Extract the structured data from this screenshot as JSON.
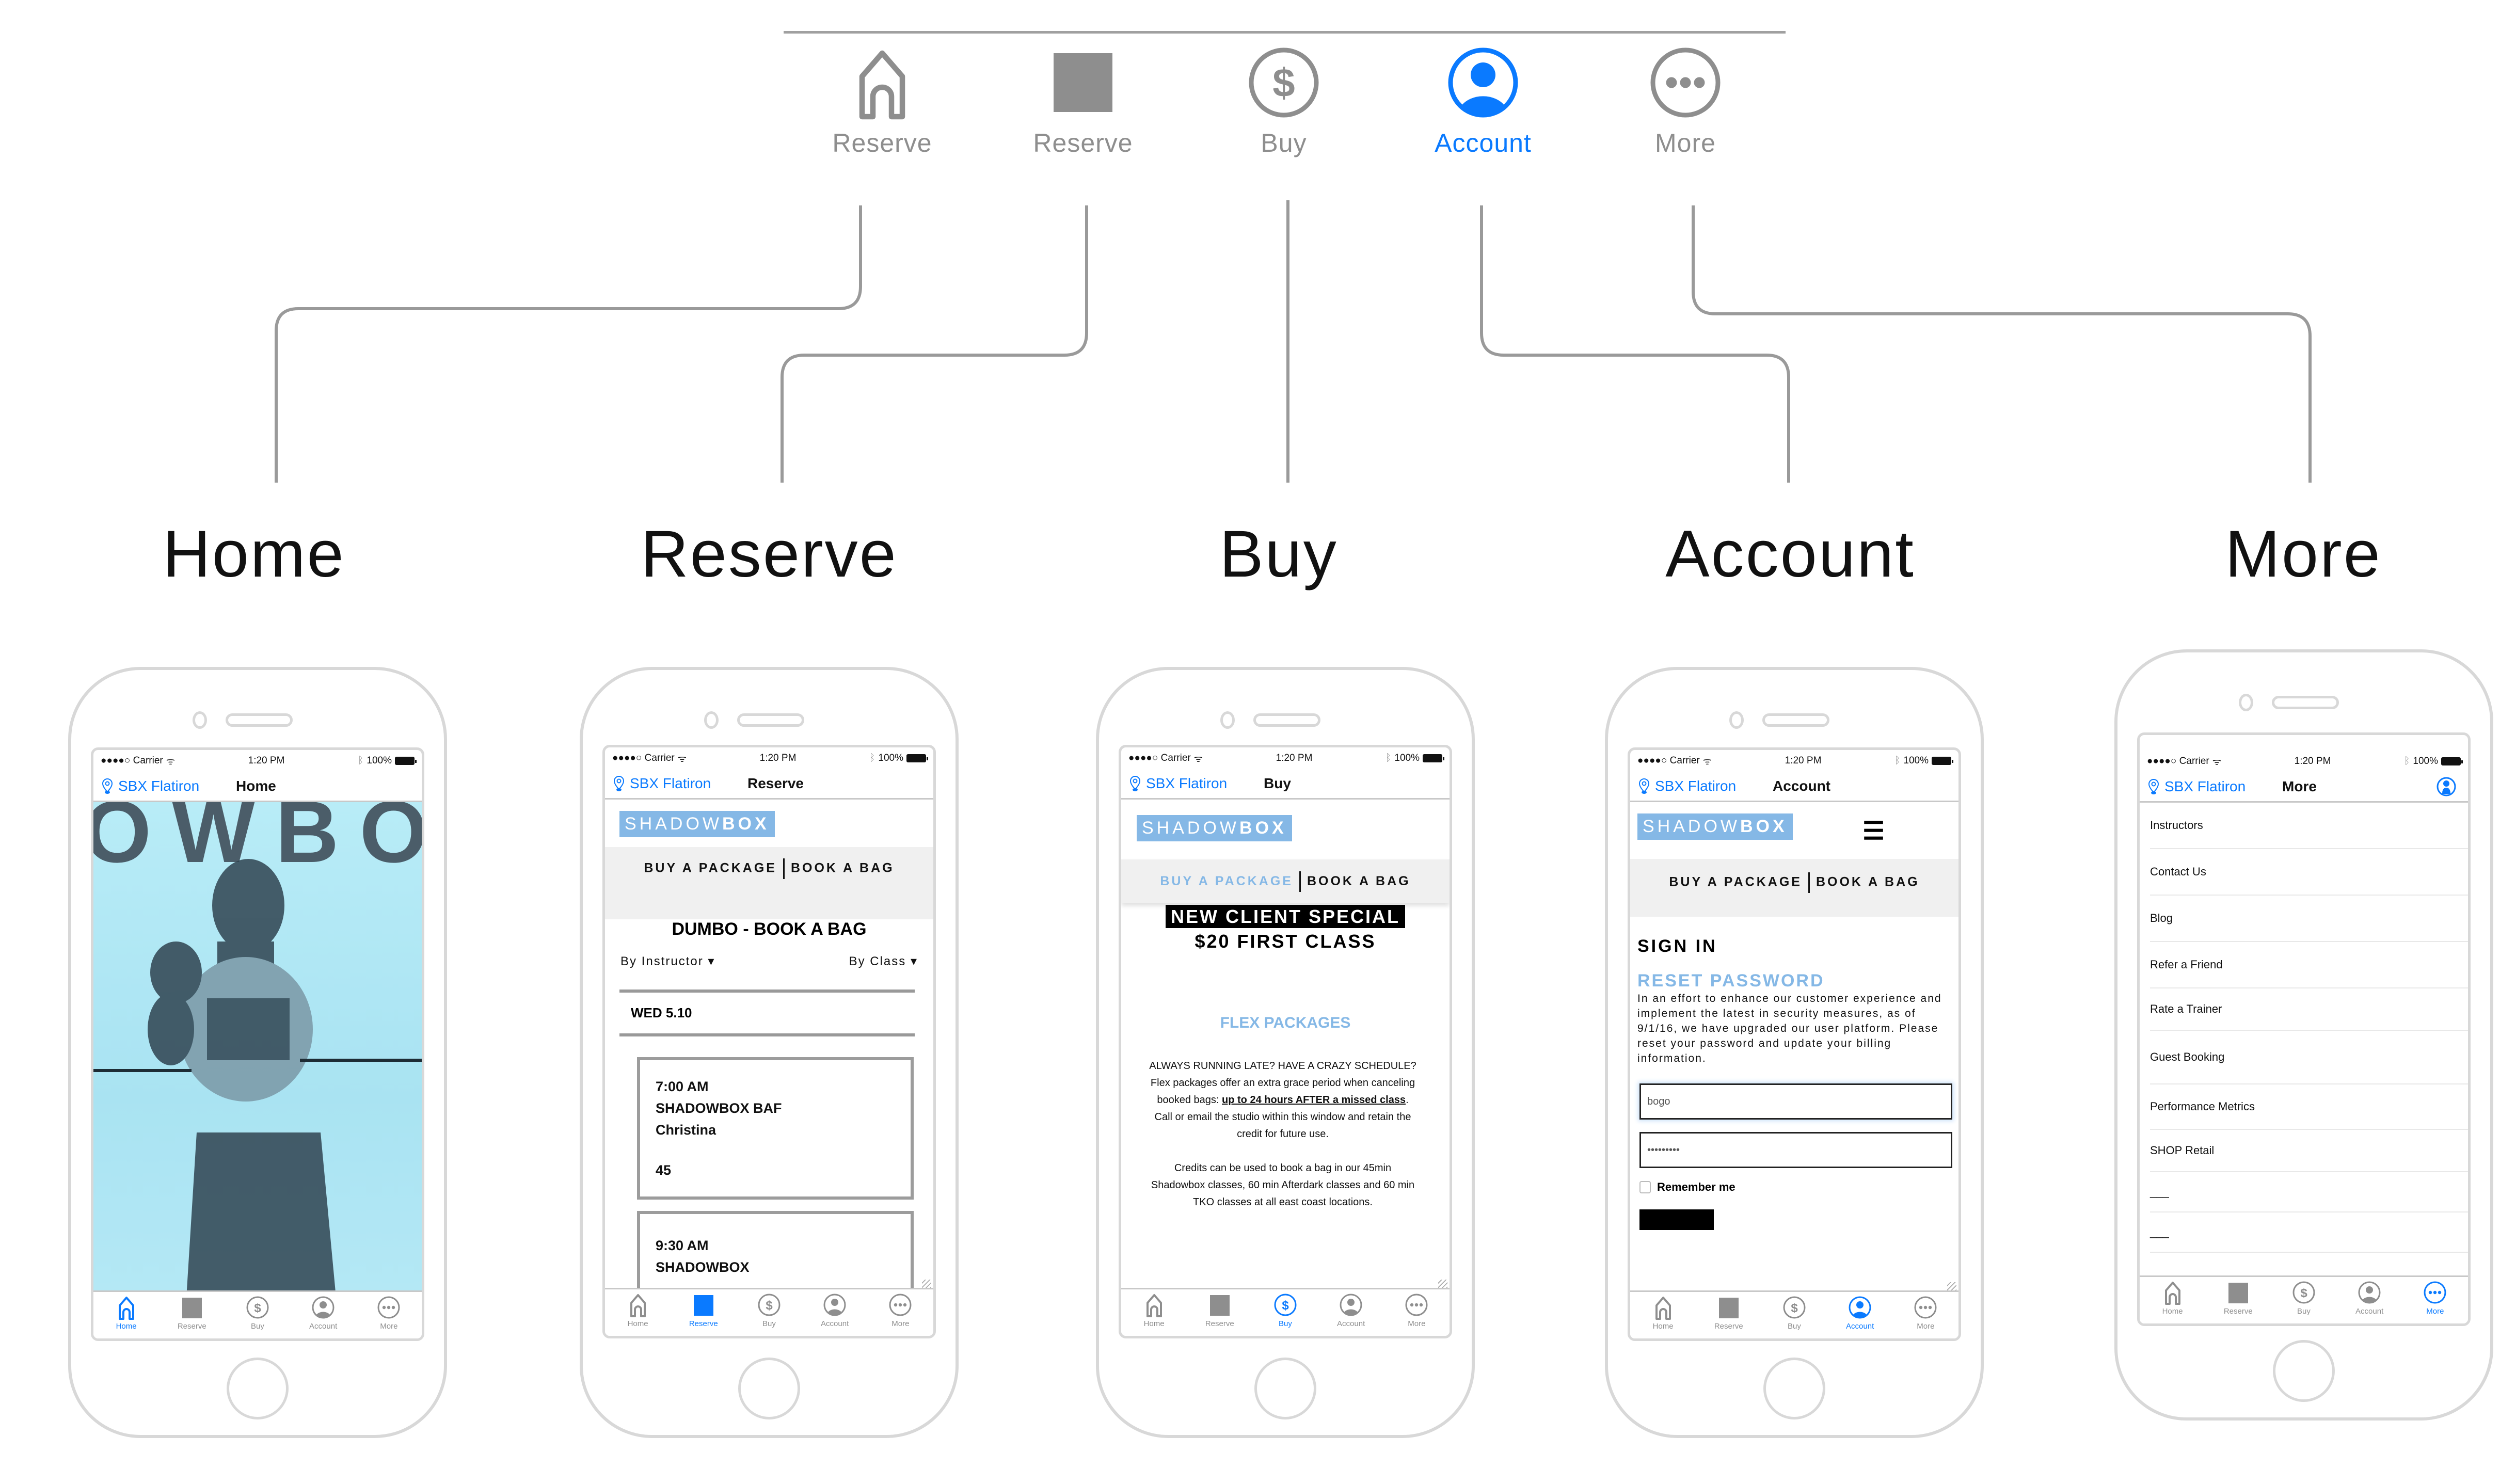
{
  "top_tabs": [
    {
      "label": "Reserve",
      "icon": "home-icon",
      "active": false
    },
    {
      "label": "Reserve",
      "icon": "reserve-square-icon",
      "active": false
    },
    {
      "label": "Buy",
      "icon": "dollar-circle-icon",
      "active": false
    },
    {
      "label": "Account",
      "icon": "account-circle-icon",
      "active": true
    },
    {
      "label": "More",
      "icon": "more-ellipsis-icon",
      "active": false
    }
  ],
  "sections": [
    "Home",
    "Reserve",
    "Buy",
    "Account",
    "More"
  ],
  "colors": {
    "accent": "#0a7aff",
    "inactive": "#8e8e8e",
    "brand_blue": "#85b8e6",
    "connector": "#9a9a9a"
  },
  "status_bar": {
    "carrier": "●●●●○ Carrier",
    "time": "1:20 PM",
    "battery": "100%"
  },
  "location": "SBX Flatiron",
  "tabbar": [
    "Home",
    "Reserve",
    "Buy",
    "Account",
    "More"
  ],
  "brand": {
    "light": "SHADOW",
    "bold": "BOX"
  },
  "pkg_nav": {
    "buy": "BUY A PACKAGE",
    "book": "BOOK A BAG"
  },
  "screens": {
    "home": {
      "title": "Home",
      "hero_text": "OWBO"
    },
    "reserve": {
      "title": "Reserve",
      "heading": "DUMBO - BOOK A BAG",
      "filter_instructor": "By Instructor ▾",
      "filter_class": "By Class ▾",
      "date": "WED 5.10",
      "classes": [
        {
          "time": "7:00 AM",
          "name": "SHADOWBOX BAF",
          "instructor": "Christina",
          "duration": "45"
        },
        {
          "time": "9:30 AM",
          "name": "SHADOWBOX",
          "instructor": "",
          "duration": ""
        }
      ]
    },
    "buy": {
      "title": "Buy",
      "special_banner": "NEW CLIENT SPECIAL",
      "special_sub": "$20 FIRST CLASS",
      "flex_heading": "FLEX PACKAGES",
      "flex_q": "ALWAYS RUNNING LATE? HAVE A CRAZY SCHEDULE?",
      "flex_p1_pre": "Flex packages offer an extra grace period when canceling booked bags: ",
      "flex_p1_link": "up to 24 hours AFTER a missed class",
      "flex_p1_post": ". Call or email the studio within this window and retain the credit for future use.",
      "flex_p2": "Credits can be used to book a bag in our 45min Shadowbox classes, 60 min Afterdark classes and 60 min TKO classes at all east coast locations."
    },
    "account": {
      "title": "Account",
      "sign_in": "SIGN IN",
      "reset_heading": "RESET PASSWORD",
      "reset_text": "In an effort to enhance our customer experience and implement the latest in security measures, as of 9/1/16, we have upgraded our user platform. Please reset your password and update your billing information.",
      "username_value": "bogo",
      "password_value": "•••••••••",
      "remember_me": "Remember me"
    },
    "more": {
      "title": "More",
      "items": [
        "Instructors",
        "Contact Us",
        "Blog",
        "Refer a Friend",
        "Rate a Trainer",
        "Guest Booking",
        "Performance Metrics",
        "SHOP Retail",
        "___",
        "___",
        "___"
      ]
    }
  }
}
